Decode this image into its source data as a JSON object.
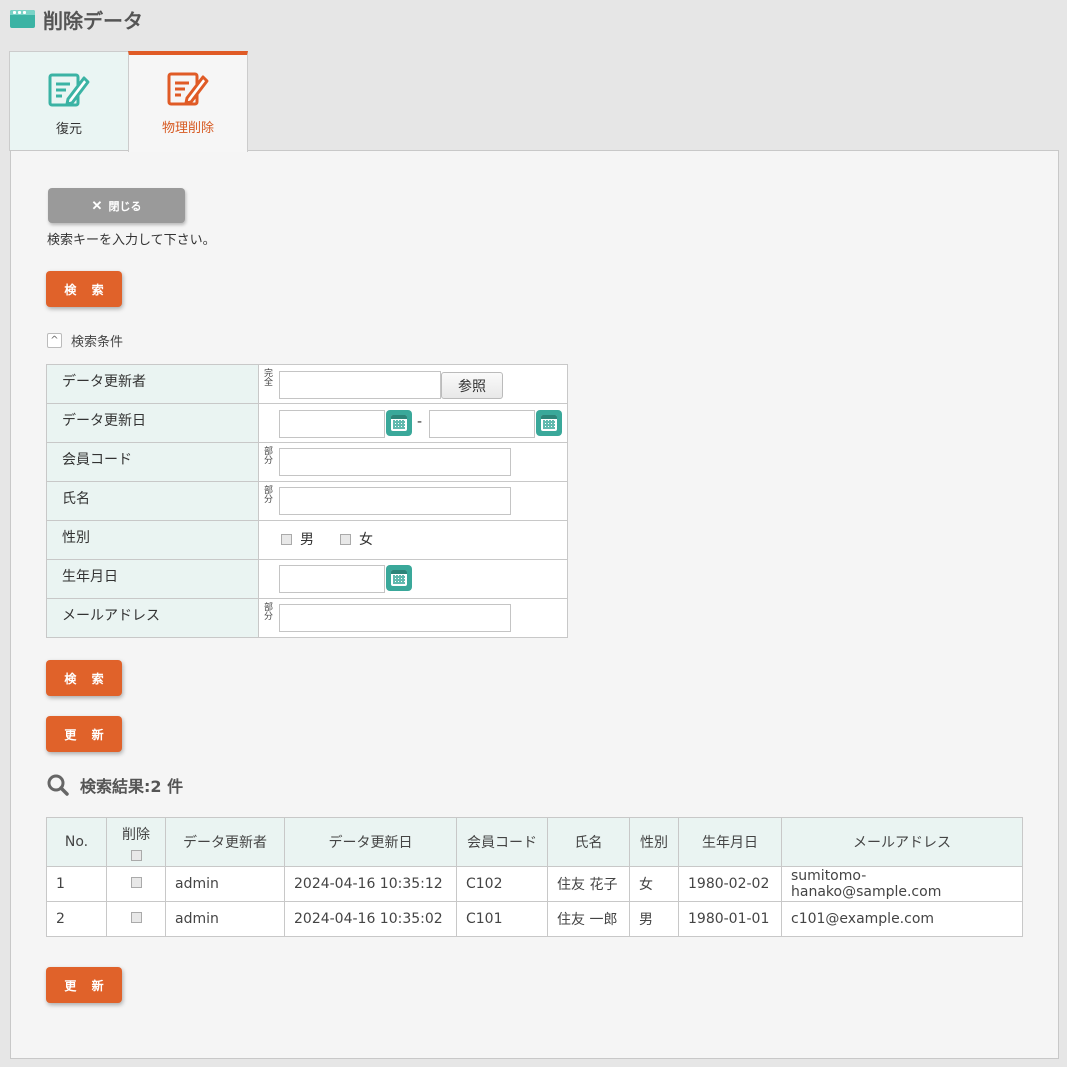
{
  "header": {
    "title": "削除データ"
  },
  "tabs": [
    {
      "label": "復元",
      "icon": "edit-document-icon",
      "color": "#3bb3a4"
    },
    {
      "label": "物理削除",
      "icon": "edit-document-icon",
      "color": "#e05b26"
    }
  ],
  "toolbar": {
    "close_label": "閉じる"
  },
  "instruction": "検索キーを入力して下さい。",
  "buttons": {
    "search_label": "検 索",
    "update_label": "更 新"
  },
  "conditions": {
    "toggle_label": "検索条件",
    "rows": {
      "updater": {
        "label": "データ更新者",
        "mode": "完全",
        "ref_label": "参照",
        "value": ""
      },
      "update_date": {
        "label": "データ更新日",
        "from": "",
        "sep": "-",
        "to": ""
      },
      "member_code": {
        "label": "会員コード",
        "mode": "部分",
        "value": ""
      },
      "name": {
        "label": "氏名",
        "mode": "部分",
        "value": ""
      },
      "gender": {
        "label": "性別",
        "opt_male": "男",
        "opt_female": "女"
      },
      "birthdate": {
        "label": "生年月日",
        "value": ""
      },
      "email": {
        "label": "メールアドレス",
        "mode": "部分",
        "value": ""
      }
    }
  },
  "results": {
    "title": "検索結果:2 件",
    "columns": [
      "No.",
      "削除",
      "データ更新者",
      "データ更新日",
      "会員コード",
      "氏名",
      "性別",
      "生年月日",
      "メールアドレス"
    ],
    "rows": [
      {
        "no": "1",
        "updater": "admin",
        "updated": "2024-04-16 10:35:12",
        "code": "C102",
        "name": "住友 花子",
        "gender": "女",
        "birth": "1980-02-02",
        "email": "sumitomo-hanako@sample.com"
      },
      {
        "no": "2",
        "updater": "admin",
        "updated": "2024-04-16 10:35:02",
        "code": "C101",
        "name": "住友 一郎",
        "gender": "男",
        "birth": "1980-01-01",
        "email": "c101@example.com"
      }
    ]
  },
  "colors": {
    "accent": "#e0622a",
    "teal": "#3bb3a4",
    "label_bg": "#eaf4f2"
  }
}
